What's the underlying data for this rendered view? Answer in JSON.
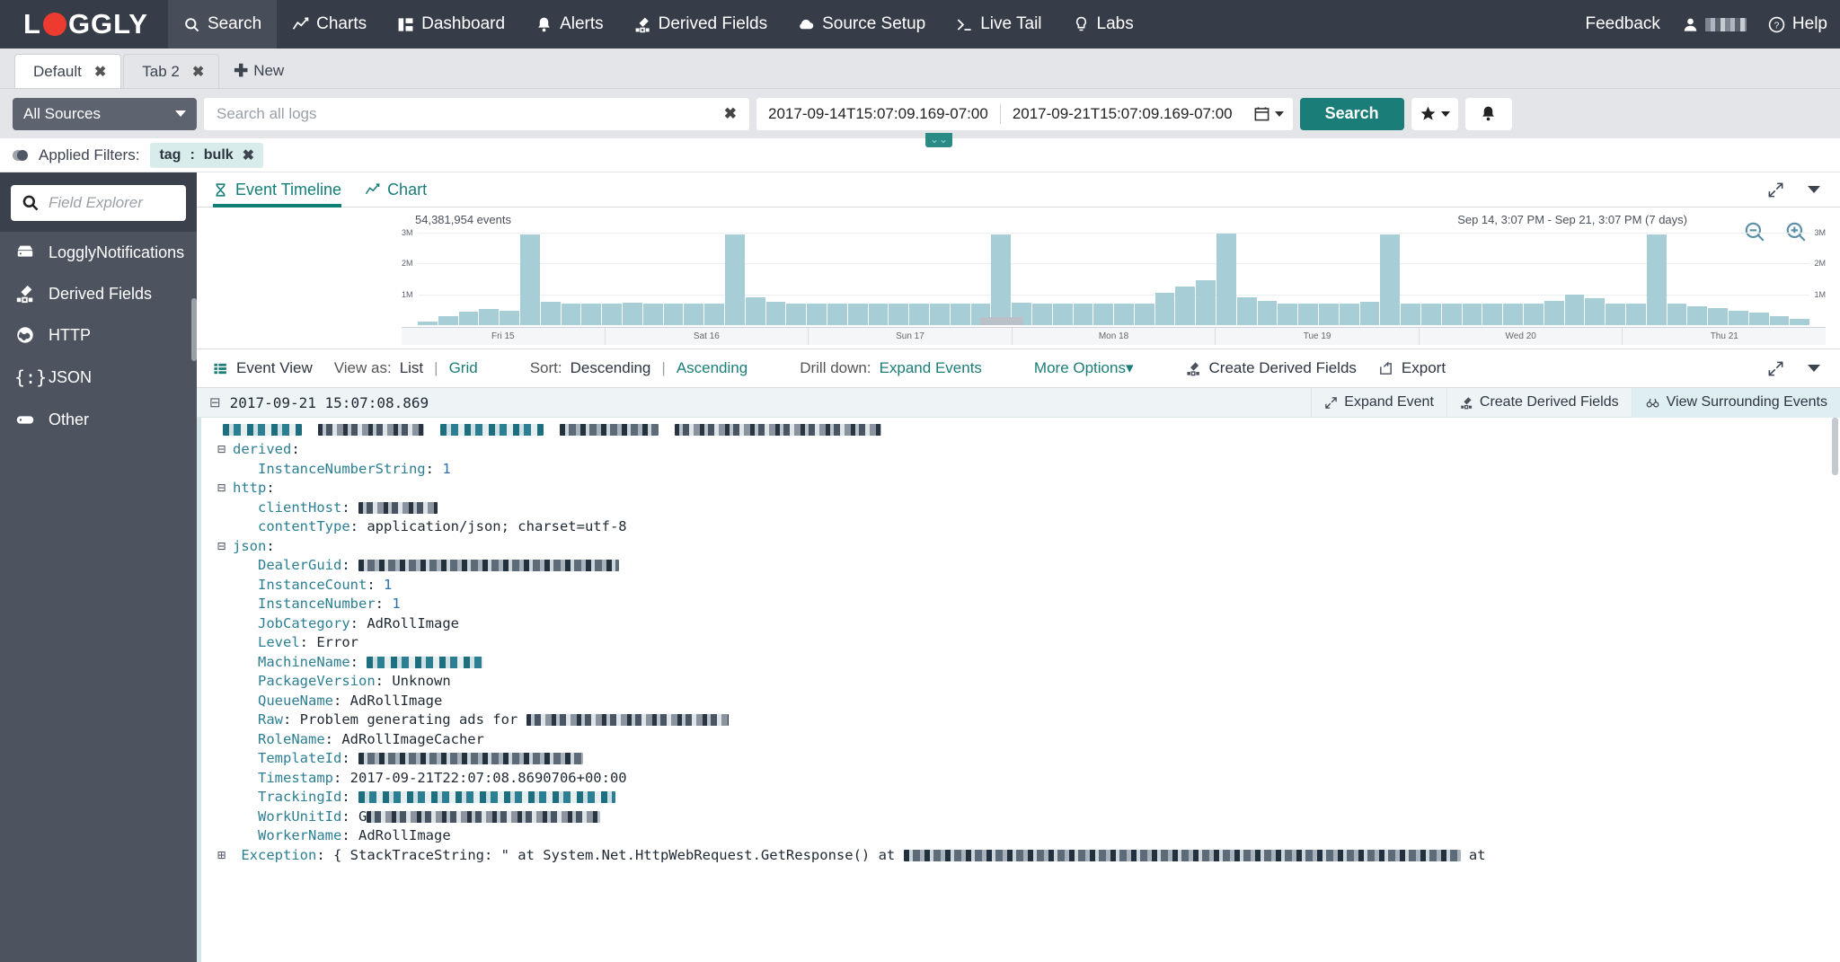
{
  "topnav": {
    "brand": "LOGGLY",
    "items": [
      {
        "label": "Search",
        "icon": "search-icon",
        "active": true
      },
      {
        "label": "Charts",
        "icon": "chart-icon",
        "active": false
      },
      {
        "label": "Dashboard",
        "icon": "dashboard-icon",
        "active": false
      },
      {
        "label": "Alerts",
        "icon": "bell-alert-icon",
        "active": false
      },
      {
        "label": "Derived Fields",
        "icon": "derived-fields-icon",
        "active": false
      },
      {
        "label": "Source Setup",
        "icon": "cloud-icon",
        "active": false
      },
      {
        "label": "Live Tail",
        "icon": "terminal-icon",
        "active": false
      },
      {
        "label": "Labs",
        "icon": "lightbulb-icon",
        "active": false
      }
    ],
    "feedback": "Feedback",
    "help": "Help",
    "account_icon": "user-icon"
  },
  "tabbar": {
    "tabs": [
      {
        "label": "Default",
        "active": false,
        "close": "✖"
      },
      {
        "label": "Tab 2",
        "active": true,
        "close": "✖"
      }
    ],
    "new_label": "New",
    "new_plus": "✚"
  },
  "search": {
    "sources_label": "All Sources",
    "query_value": "",
    "query_placeholder": "Search all logs",
    "clear_icon": "✖",
    "date_from": "2017-09-14T15:07:09.169-07:00",
    "date_to": "2017-09-21T15:07:09.169-07:00",
    "calendar_icon": "calendar-icon",
    "search_button": "Search",
    "favorites_icon": "star-icon",
    "alerts_icon": "bell-icon",
    "expand_chevron": "⌄⌄"
  },
  "filters": {
    "label": "Applied Filters:",
    "chips": [
      {
        "key": "tag",
        "sep": ":",
        "value": "bulk",
        "close": "✖"
      }
    ]
  },
  "sidebar": {
    "field_explorer_placeholder": "Field Explorer",
    "field_explorer_value": "",
    "search_icon": "search-icon",
    "items": [
      {
        "label": "LogglyNotifications",
        "icon": "server-icon"
      },
      {
        "label": "Derived Fields",
        "icon": "derived-fields-icon"
      },
      {
        "label": "HTTP",
        "icon": "globe-icon"
      },
      {
        "label": "JSON",
        "icon": "braces-icon"
      },
      {
        "label": "Other",
        "icon": "database-icon"
      }
    ]
  },
  "panel": {
    "tabs": [
      {
        "label": "Event Timeline",
        "icon": "hourglass-icon",
        "active": true
      },
      {
        "label": "Chart",
        "icon": "line-chart-icon",
        "active": false
      }
    ],
    "expand_icon": "expand-arrows-icon",
    "menu_icon": "chevron-down-icon"
  },
  "timeline": {
    "events_count": "54,381,954 events",
    "range_label": "Sep 14, 3:07 PM - Sep 21, 3:07 PM  (7 days)",
    "zoom_out_icon": "zoom-out-icon",
    "zoom_in_icon": "zoom-in-icon"
  },
  "chart_data": {
    "type": "bar",
    "title": "Event Timeline",
    "subtitle": "54,381,954 events",
    "xlabel": "",
    "ylabel": "events",
    "ylim": [
      0,
      3000000
    ],
    "ytick_labels": [
      "1M",
      "2M",
      "3M"
    ],
    "ytick_values": [
      1000000,
      2000000,
      3000000
    ],
    "grid": true,
    "legend": "none",
    "xtick_labels": [
      "Fri 15",
      "Sat 16",
      "Sun 17",
      "Mon 18",
      "Tue 19",
      "Wed 20",
      "Thu 21"
    ],
    "bar_color": "#a7cdd7",
    "values": [
      120000,
      300000,
      430000,
      520000,
      480000,
      2950000,
      760000,
      700000,
      690000,
      700000,
      720000,
      700000,
      700000,
      690000,
      700000,
      2930000,
      900000,
      760000,
      700000,
      690000,
      700000,
      700000,
      690000,
      700000,
      690000,
      700000,
      690000,
      700000,
      2940000,
      720000,
      690000,
      700000,
      690000,
      700000,
      690000,
      700000,
      1050000,
      1250000,
      1450000,
      2960000,
      900000,
      780000,
      700000,
      690000,
      700000,
      690000,
      760000,
      2950000,
      700000,
      690000,
      700000,
      690000,
      700000,
      690000,
      700000,
      800000,
      980000,
      870000,
      700000,
      690000,
      2940000,
      700000,
      620000,
      560000,
      480000,
      420000,
      300000,
      200000
    ]
  },
  "event_toolbar": {
    "event_view": "Event View",
    "view_as_label": "View as:",
    "view_list": "List",
    "view_grid": "Grid",
    "sort_label": "Sort:",
    "sort_desc": "Descending",
    "sort_asc": "Ascending",
    "drill_label": "Drill down:",
    "expand_events": "Expand Events",
    "more_options": "More Options",
    "more_options_caret": "▾",
    "create_derived_fields": "Create Derived Fields",
    "export": "Export",
    "separator": "|",
    "expand_icon": "expand-arrows-icon",
    "menu_icon": "chevron-down-icon"
  },
  "event": {
    "collapse_icon": "⊟",
    "timestamp": "2017-09-21 15:07:08.869",
    "actions": [
      {
        "label": "Expand Event",
        "icon": "expand-arrows-icon",
        "highlight": false
      },
      {
        "label": "Create Derived Fields",
        "icon": "derived-fields-icon",
        "highlight": false
      },
      {
        "label": "View Surrounding Events",
        "icon": "binoculars-icon",
        "highlight": true
      }
    ]
  },
  "log": {
    "groups": [
      {
        "name": "derived",
        "toggle": "⊟",
        "fields": [
          {
            "key": "InstanceNumberString",
            "value": "1",
            "type": "num"
          }
        ]
      },
      {
        "name": "http",
        "toggle": "⊟",
        "fields": [
          {
            "key": "clientHost",
            "value": "",
            "type": "redacted",
            "redact_width": 88
          },
          {
            "key": "contentType",
            "value": "application/json; charset=utf-8",
            "type": "text"
          }
        ]
      },
      {
        "name": "json",
        "toggle": "⊟",
        "fields": [
          {
            "key": "DealerGuid",
            "value": "",
            "type": "redacted",
            "redact_width": 290
          },
          {
            "key": "InstanceCount",
            "value": "1",
            "type": "num"
          },
          {
            "key": "InstanceNumber",
            "value": "1",
            "type": "num"
          },
          {
            "key": "JobCategory",
            "value": "AdRollImage",
            "type": "text"
          },
          {
            "key": "Level",
            "value": "Error",
            "type": "text"
          },
          {
            "key": "MachineName",
            "value": "",
            "type": "redacted",
            "redact_width": 130
          },
          {
            "key": "PackageVersion",
            "value": "Unknown",
            "type": "text"
          },
          {
            "key": "QueueName",
            "value": "AdRollImage",
            "type": "text"
          },
          {
            "key": "Raw",
            "value": "Problem generating ads for ",
            "type": "text-redacted",
            "redact_width": 225
          },
          {
            "key": "RoleName",
            "value": "AdRollImageCacher",
            "type": "text"
          },
          {
            "key": "TemplateId",
            "value": "",
            "type": "redacted",
            "redact_width": 250
          },
          {
            "key": "Timestamp",
            "value": "2017-09-21T22:07:08.8690706+00:00",
            "type": "text"
          },
          {
            "key": "TrackingId",
            "value": "",
            "type": "redacted",
            "redact_width": 286
          },
          {
            "key": "WorkUnitId",
            "value": "G",
            "type": "text-redacted",
            "redact_width": 260
          },
          {
            "key": "WorkerName",
            "value": "AdRollImage",
            "type": "text"
          }
        ]
      }
    ],
    "exception_line": {
      "toggle": "⊞",
      "key": "Exception",
      "prefix": ": { StackTraceString: \" at System.Net.HttpWebRequest.GetResponse() at ",
      "suffix": "at",
      "redact_width": 620
    }
  }
}
